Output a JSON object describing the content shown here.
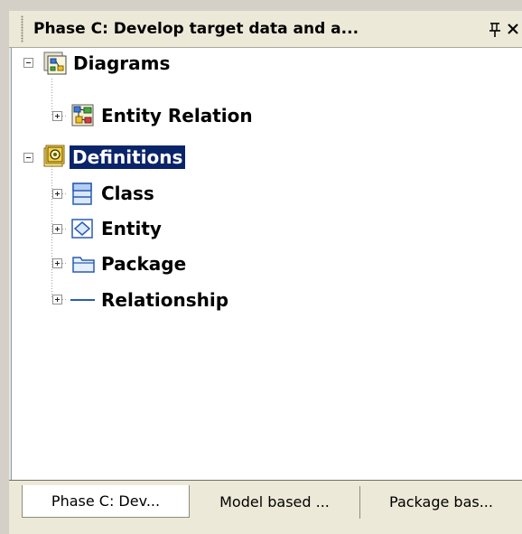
{
  "panel": {
    "title": "Phase C: Develop target data and a...",
    "pin_icon": "pin-icon",
    "close_icon": "close-icon"
  },
  "tree": {
    "nodes": [
      {
        "label": "Diagrams",
        "icon": "diagrams-folder-icon",
        "expander": "minus"
      },
      {
        "label": "Entity Relation",
        "icon": "entity-relation-diagram-icon",
        "expander": "plus"
      },
      {
        "label": "Definitions",
        "icon": "definitions-folder-icon",
        "expander": "minus",
        "selected": true
      },
      {
        "label": "Class",
        "icon": "class-icon",
        "expander": "plus"
      },
      {
        "label": "Entity",
        "icon": "entity-icon",
        "expander": "plus"
      },
      {
        "label": "Package",
        "icon": "package-folder-icon",
        "expander": "plus"
      },
      {
        "label": "Relationship",
        "icon": "relationship-line-icon",
        "expander": "plus"
      }
    ]
  },
  "tabs": [
    {
      "label": "Phase C: Dev...",
      "active": true
    },
    {
      "label": "Model based ..."
    },
    {
      "label": "Package bas..."
    }
  ],
  "colors": {
    "selection_bg": "#0a246a",
    "panel_bg": "#ece9d8",
    "tree_bg": "#ffffff"
  }
}
